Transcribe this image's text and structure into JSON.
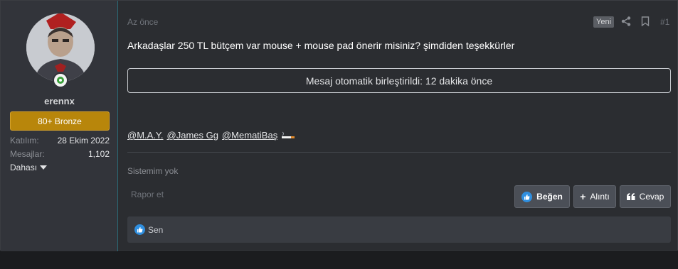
{
  "user": {
    "name": "erennx",
    "rank": "80+ Bronze",
    "stats": [
      {
        "label": "Katılım:",
        "value": "28 Ekim 2022"
      },
      {
        "label": "Mesajlar:",
        "value": "1,102"
      }
    ],
    "more_label": "Dahası",
    "online_color": "#3aa03a"
  },
  "post": {
    "time": "Az önce",
    "new_badge": "Yeni",
    "number": "#1",
    "message": "Arkadaşlar 250 TL bütçem var mouse + mouse pad önerir misiniz? şimdiden teşekkürler",
    "merge_notice": "Mesaj otomatik birleştirildi: 12 dakika önce",
    "mentions": [
      "@M.A.Y.",
      "@James Gg",
      "@MematiBaş"
    ],
    "signature": "Sistemim yok",
    "report": "Rapor et"
  },
  "actions": {
    "like": "Beğen",
    "quote": "Alıntı",
    "reply": "Cevap"
  },
  "reactions": {
    "text": "Sen",
    "icon": "like-icon"
  },
  "colors": {
    "accent": "#2f8fe0",
    "rank_badge": "#b8860b"
  }
}
